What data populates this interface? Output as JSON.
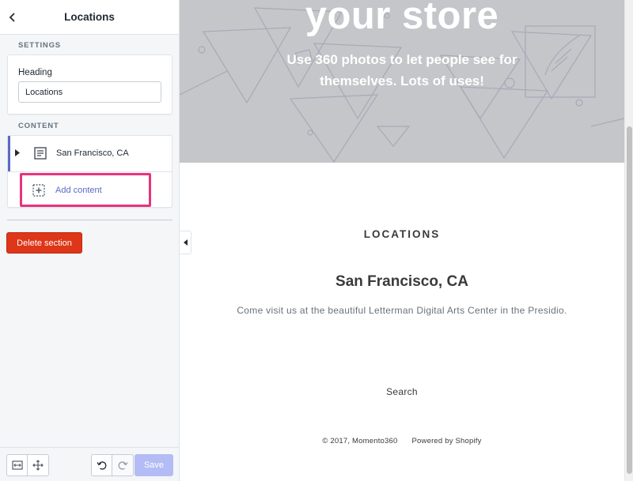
{
  "sidebar": {
    "title": "Locations",
    "settings_label": "SETTINGS",
    "heading_field": {
      "label": "Heading",
      "value": "Locations"
    },
    "content_label": "CONTENT",
    "blocks": [
      {
        "label": "San Francisco, CA"
      }
    ],
    "add_content_label": "Add content",
    "delete_label": "Delete section",
    "save_label": "Save"
  },
  "preview": {
    "hero": {
      "title": "your store",
      "subtitle": "Use 360 photos to let people see for themselves. Lots of uses!"
    },
    "locations_heading": "LOCATIONS",
    "location_name": "San Francisco, CA",
    "location_description": "Come visit us at the beautiful Letterman Digital Arts Center in the Presidio.",
    "footer_link": "Search",
    "copyright": "© 2017, Momento360",
    "powered_by": "Powered by Shopify"
  },
  "colors": {
    "accent": "#5c6ac4",
    "danger": "#de3618",
    "highlight": "#e8337c",
    "save_disabled": "#b3bcf5",
    "hero_bg": "#c5c6c9"
  },
  "icons": {
    "back": "chevron-left-icon",
    "expand": "caret-right-icon",
    "block": "document-icon",
    "add": "add-dashed-icon",
    "collapse": "caret-left-icon",
    "tools": [
      "resize-horizontal-icon",
      "move-icon",
      "undo-icon",
      "redo-icon"
    ]
  }
}
